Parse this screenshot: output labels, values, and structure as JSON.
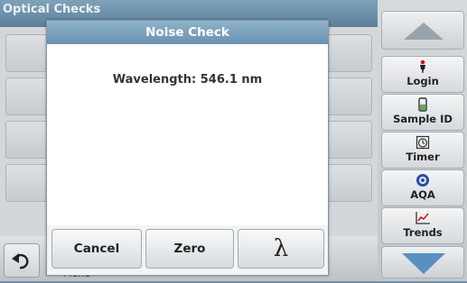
{
  "background": {
    "title": "Optical Checks",
    "footer_menu_label": "Menu"
  },
  "dialog": {
    "title": "Noise Check",
    "message": "Wavelength: 546.1 nm",
    "buttons": {
      "cancel": "Cancel",
      "zero": "Zero",
      "lambda": "λ"
    }
  },
  "sidebar": {
    "items": [
      {
        "label": "Login",
        "icon": "person-icon"
      },
      {
        "label": "Sample ID",
        "icon": "sample-vial-icon"
      },
      {
        "label": "Timer",
        "icon": "timer-icon"
      },
      {
        "label": "AQA",
        "icon": "aqa-icon"
      },
      {
        "label": "Trends",
        "icon": "trends-chart-icon"
      }
    ]
  },
  "colors": {
    "accent": "#6a92b0",
    "nav_arrow": "#5b8fc1"
  }
}
